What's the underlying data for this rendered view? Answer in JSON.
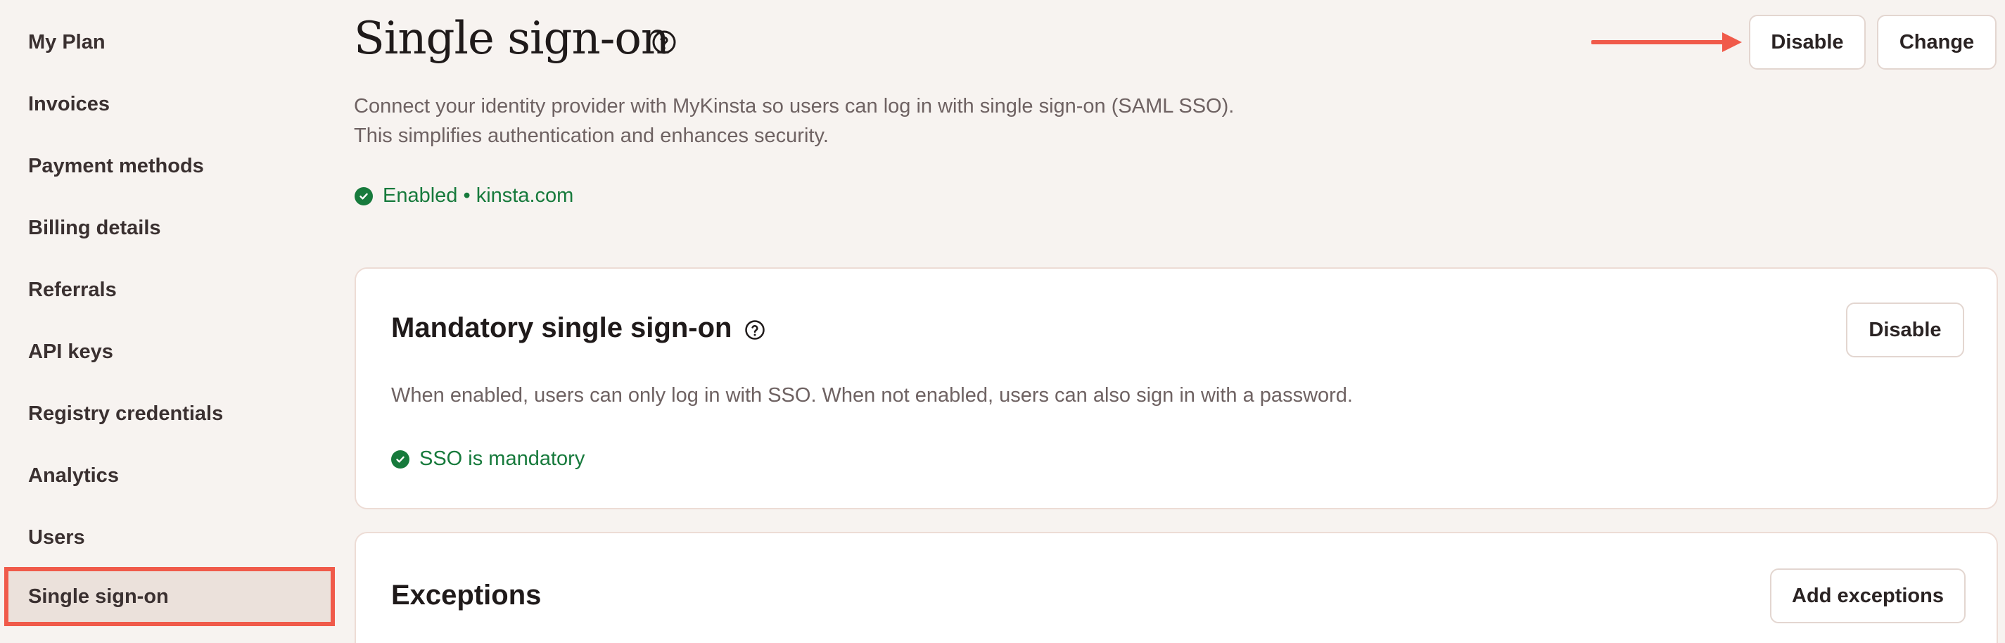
{
  "sidebar": {
    "items": [
      {
        "label": "My Plan"
      },
      {
        "label": "Invoices"
      },
      {
        "label": "Payment methods"
      },
      {
        "label": "Billing details"
      },
      {
        "label": "Referrals"
      },
      {
        "label": "API keys"
      },
      {
        "label": "Registry credentials"
      },
      {
        "label": "Analytics"
      },
      {
        "label": "Users"
      },
      {
        "label": "Single sign-on"
      }
    ],
    "active_item": "Single sign-on"
  },
  "header": {
    "title": "Single sign-on",
    "help_icon": "question-circle-icon",
    "description_line1": "Connect your identity provider with MyKinsta so users can log in with single sign-on (SAML SSO).",
    "description_line2": "This simplifies authentication and enhances security.",
    "status_text": "Enabled • kinsta.com",
    "disable_label": "Disable",
    "change_label": "Change"
  },
  "mandatory_card": {
    "title": "Mandatory single sign-on",
    "help_icon": "question-circle-icon",
    "description": "When enabled, users can only log in with SSO. When not enabled, users can also sign in with a password.",
    "status_text": "SSO is mandatory",
    "disable_label": "Disable"
  },
  "exceptions_card": {
    "title": "Exceptions",
    "add_label": "Add exceptions"
  },
  "colors": {
    "accent": "#f05a4a",
    "success": "#177a3c",
    "background": "#f7f3f0"
  }
}
